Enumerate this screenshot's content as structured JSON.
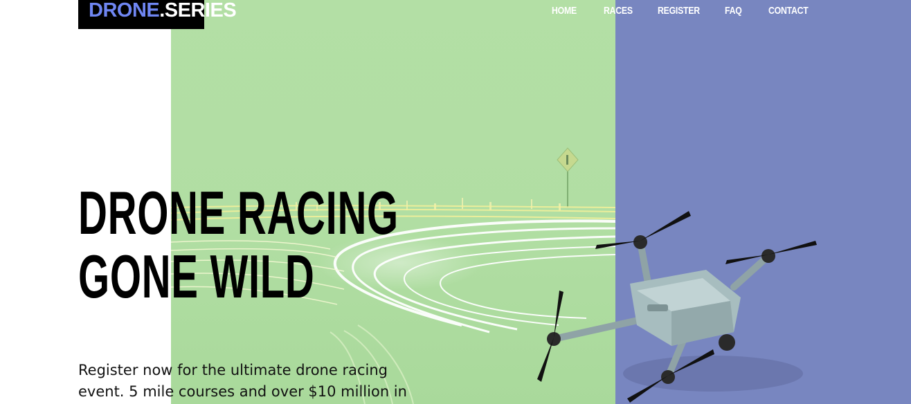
{
  "logo": {
    "part1": "DRONE",
    "part2": ".SERIES"
  },
  "nav": {
    "items": [
      {
        "label": "HOME"
      },
      {
        "label": "RACES"
      },
      {
        "label": "REGISTER"
      },
      {
        "label": "FAQ"
      },
      {
        "label": "CONTACT"
      }
    ]
  },
  "hero": {
    "title_line1": "DRONE RACING",
    "title_line2": "GONE WILD",
    "description": "Register now for the ultimate drone racing event. 5 mile courses and over $10 million in"
  },
  "colors": {
    "green_panel": "#b3dfa5",
    "purple_panel": "#7886c0",
    "logo_accent": "#6f86f2",
    "logo_bg": "#000000"
  },
  "images": {
    "background": "night-road-light-trails-image",
    "drone": "quadcopter-drone-image"
  }
}
